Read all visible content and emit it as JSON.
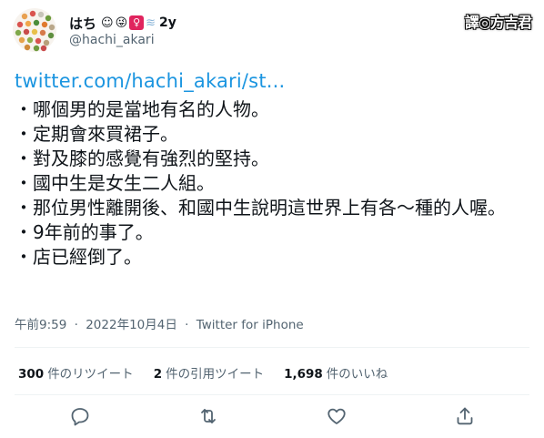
{
  "user": {
    "display_name": "はち",
    "emoji_text": "2y",
    "handle": "@hachi_akari",
    "avatar_icon": "polka-dot-avatar"
  },
  "stamp_text": "譯◎方吉君",
  "tweet": {
    "link": "twitter.com/hachi_akari/st...",
    "lines": [
      "・哪個男的是當地有名的人物。",
      "・定期會來買裙子。",
      "・對及膝的感覺有強烈的堅持。",
      "・國中生是女生二人組。",
      "・那位男性離開後、和國中生說明這世界上有各～種的人喔。",
      "・9年前的事了。",
      "・店已經倒了。"
    ],
    "time": "午前9:59",
    "date": "2022年10月4日",
    "source": "Twitter for iPhone"
  },
  "stats": {
    "retweets_count": "300",
    "retweets_label": "件のリツイート",
    "quotes_count": "2",
    "quotes_label": "件の引用ツイート",
    "likes_count": "1,698",
    "likes_label": "件のいいね"
  },
  "actions": [
    "reply-icon",
    "retweet-icon",
    "like-icon",
    "share-icon"
  ],
  "colors": {
    "link": "#1b95e0",
    "muted": "#536471",
    "text": "#0f1419"
  }
}
